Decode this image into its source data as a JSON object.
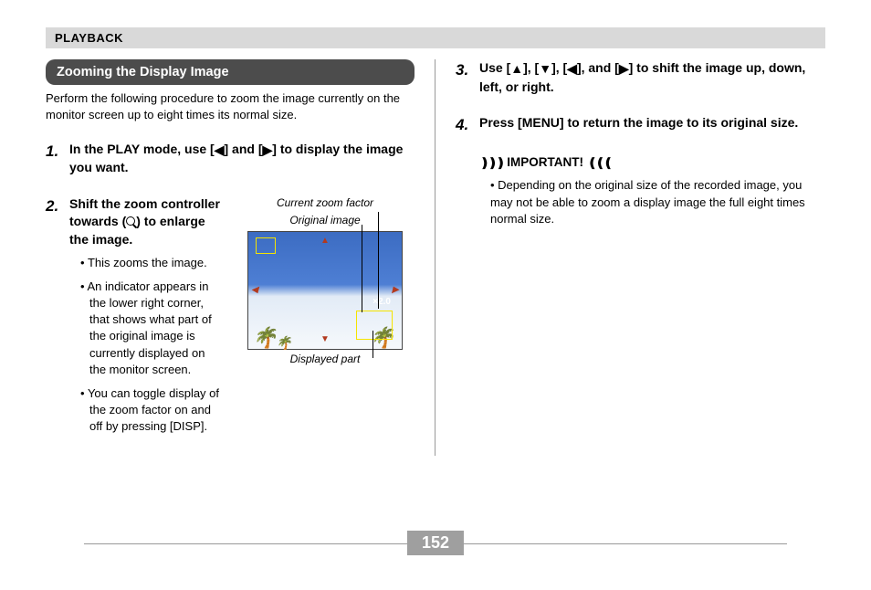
{
  "header": "PLAYBACK",
  "page_number": "152",
  "section_title": "Zooming the Display Image",
  "intro": "Perform the following procedure to zoom the image currently on the monitor screen up to eight times its normal size.",
  "step1_num": "1.",
  "step1_head_a": "In the PLAY mode, use [",
  "step1_head_b": "] and [",
  "step1_head_c": "] to display the image you want.",
  "step2_num": "2.",
  "step2_head_a": "Shift the zoom controller towards (",
  "step2_head_b": ") to enlarge the image.",
  "step2_b1": "This zooms the image.",
  "step2_b2": "An indicator appears in the lower right corner, that shows what part of the original image is currently displayed on the monitor screen.",
  "step2_b3": "You can toggle display of the zoom factor on and off by pressing [DISP].",
  "fig_label_top1": "Current zoom factor",
  "fig_label_top2": "Original image",
  "fig_label_bottom": "Displayed part",
  "zoom_factor_text": "×2.0",
  "step3_num": "3.",
  "step3_head_a": "Use [",
  "step3_head_b": "], [",
  "step3_head_c": "], [",
  "step3_head_d": "], and [",
  "step3_head_e": "] to shift the image up, down, left, or right.",
  "step4_num": "4.",
  "step4_head": "Press [MENU] to return the image to its original size.",
  "important_label": "IMPORTANT!",
  "important_text": "Depending on the original size of the recorded image, you may not be able to zoom a display image the full eight times normal size."
}
